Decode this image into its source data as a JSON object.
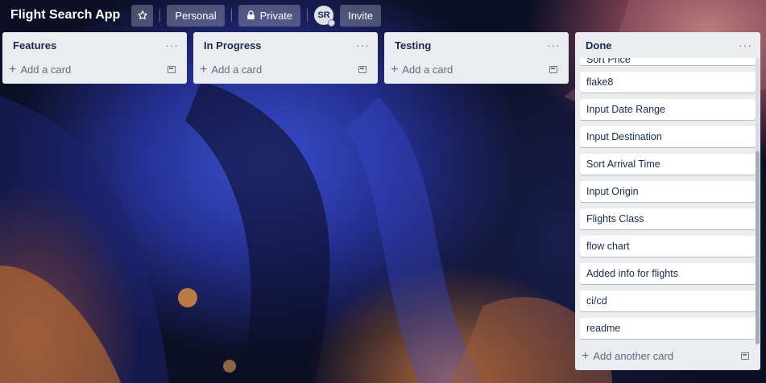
{
  "header": {
    "board_title": "Flight Search App",
    "star_icon": "star-icon",
    "workspace_label": "Personal",
    "visibility_label": "Private",
    "avatar_initials": "SR",
    "invite_label": "Invite"
  },
  "lists": [
    {
      "title": "Features",
      "add_card_label": "Add a card",
      "cards": []
    },
    {
      "title": "In Progress",
      "add_card_label": "Add a card",
      "cards": []
    },
    {
      "title": "Testing",
      "add_card_label": "Add a card",
      "cards": []
    },
    {
      "title": "Done",
      "add_card_label": "Add another card",
      "cards": [
        "Sort Price",
        "flake8",
        "Input Date Range",
        "Input Destination",
        "Sort Arrival Time",
        "Input Origin",
        "Flights Class",
        "flow chart",
        "Added info for flights",
        "ci/cd",
        "readme"
      ]
    }
  ],
  "menu_glyph": "···",
  "plus_glyph": "+"
}
